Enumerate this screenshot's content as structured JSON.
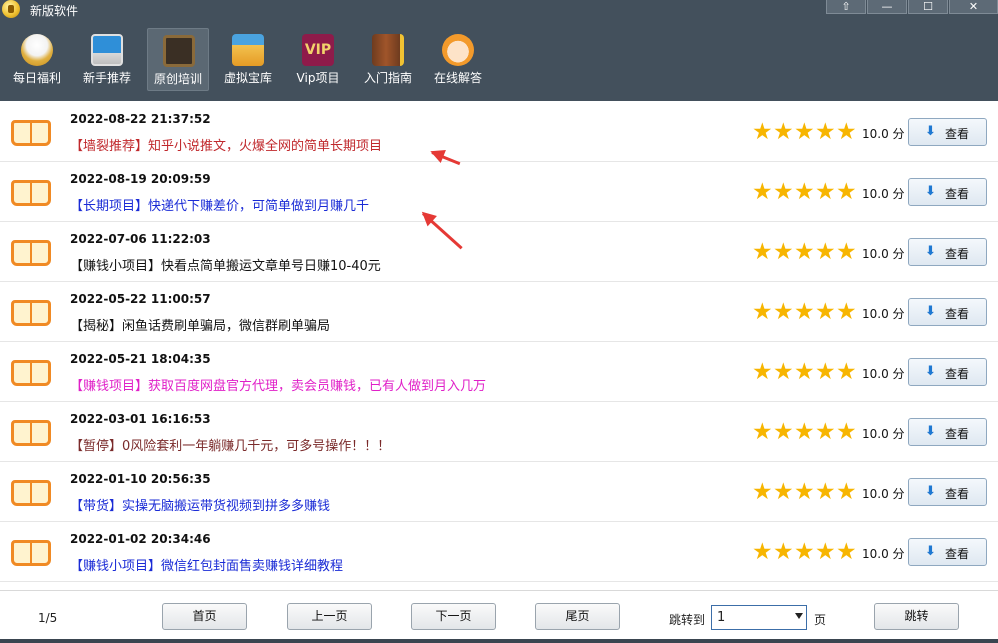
{
  "window": {
    "title": "新版软件",
    "controls": [
      {
        "name": "pin-button",
        "icon": "pin-icon",
        "glyph": "⇧"
      },
      {
        "name": "minimize-button",
        "icon": "minimize-icon",
        "glyph": "—"
      },
      {
        "name": "maximize-button",
        "icon": "maximize-icon",
        "glyph": "☐"
      },
      {
        "name": "close-button",
        "icon": "close-icon",
        "glyph": "✕"
      }
    ]
  },
  "toolbar": {
    "items": [
      {
        "label": "每日福利",
        "icon": "lucky-cat-icon",
        "active": false
      },
      {
        "label": "新手推荐",
        "icon": "computer-icon",
        "active": false
      },
      {
        "label": "原创培训",
        "icon": "blackboard-icon",
        "active": true
      },
      {
        "label": "虚拟宝库",
        "icon": "store-icon",
        "active": false
      },
      {
        "label": "Vip项目",
        "icon": "vip-icon",
        "active": false,
        "icon_text": "VIP"
      },
      {
        "label": "入门指南",
        "icon": "guide-book-icon",
        "active": false
      },
      {
        "label": "在线解答",
        "icon": "support-agent-icon",
        "active": false
      }
    ]
  },
  "list": {
    "score_suffix": "分",
    "view_label": "查看",
    "rows": [
      {
        "date": "2022-08-22 21:37:52",
        "title": "【墙裂推荐】知乎小说推文，火爆全网的简单长期项目",
        "color": "#c0282c",
        "stars": 5,
        "score": "10.0"
      },
      {
        "date": "2022-08-19 20:09:59",
        "title": "【长期项目】快递代下赚差价，可简单做到月赚几千",
        "color": "#1a2bd6",
        "stars": 5,
        "score": "10.0"
      },
      {
        "date": "2022-07-06 11:22:03",
        "title": "【赚钱小项目】快看点简单搬运文章单号日赚10-40元",
        "color": "#111111",
        "stars": 5,
        "score": "10.0"
      },
      {
        "date": "2022-05-22 11:00:57",
        "title": "【揭秘】闲鱼话费刷单骗局，微信群刷单骗局",
        "color": "#111111",
        "stars": 5,
        "score": "10.0"
      },
      {
        "date": "2022-05-21 18:04:35",
        "title": "【赚钱项目】获取百度网盘官方代理，卖会员赚钱，已有人做到月入几万",
        "color": "#e020c8",
        "stars": 5,
        "score": "10.0"
      },
      {
        "date": "2022-03-01 16:16:53",
        "title": "【暂停】0风险套利一年躺赚几千元，可多号操作！！！",
        "color": "#7a2a2a",
        "stars": 5,
        "score": "10.0"
      },
      {
        "date": "2022-01-10 20:56:35",
        "title": "【带货】实操无脑搬运带货视频到拼多多赚钱",
        "color": "#1a2bd6",
        "stars": 5,
        "score": "10.0"
      },
      {
        "date": "2022-01-02 20:34:46",
        "title": "【赚钱小项目】微信红包封面售卖赚钱详细教程",
        "color": "#1a2bd6",
        "stars": 5,
        "score": "10.0"
      }
    ]
  },
  "pagination": {
    "page_info": "1/5",
    "first": "首页",
    "prev": "上一页",
    "next": "下一页",
    "last": "尾页",
    "jump_label": "跳转到",
    "jump_value": "1",
    "page_unit": "页",
    "jump_button": "跳转"
  },
  "colors": {
    "header_bg": "#43505c",
    "star": "#f7b500",
    "book_icon": "#f08a24",
    "annotation_arrow": "#e53935"
  }
}
